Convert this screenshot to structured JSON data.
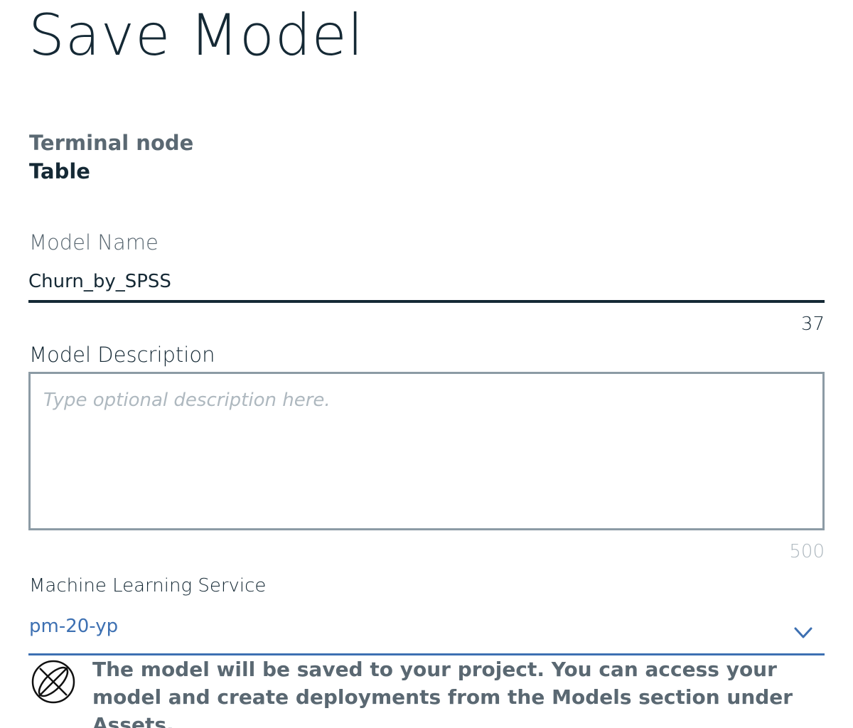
{
  "dialog": {
    "title": "Save Model"
  },
  "terminal_node": {
    "label": "Terminal node",
    "value": "Table"
  },
  "model_name": {
    "label": "Model Name",
    "value": "Churn_by_SPSS",
    "remaining_chars": "37"
  },
  "model_description": {
    "label": "Model Description",
    "placeholder": "Type optional description here.",
    "remaining_chars": "500"
  },
  "ml_service": {
    "label": "Machine Learning Service",
    "selected": "pm-20-yp"
  },
  "info": {
    "message": "The model will be saved to your project. You can access your model and create deployments from the Models section under Assets."
  },
  "colors": {
    "text_primary": "#152935",
    "text_secondary": "#5a6872",
    "accent_blue": "#3d70b2",
    "border_gray": "#8c9ba5",
    "placeholder_gray": "#aeb8bf"
  },
  "icons": {
    "info": "globe-info-icon",
    "dropdown": "chevron-down-icon"
  }
}
